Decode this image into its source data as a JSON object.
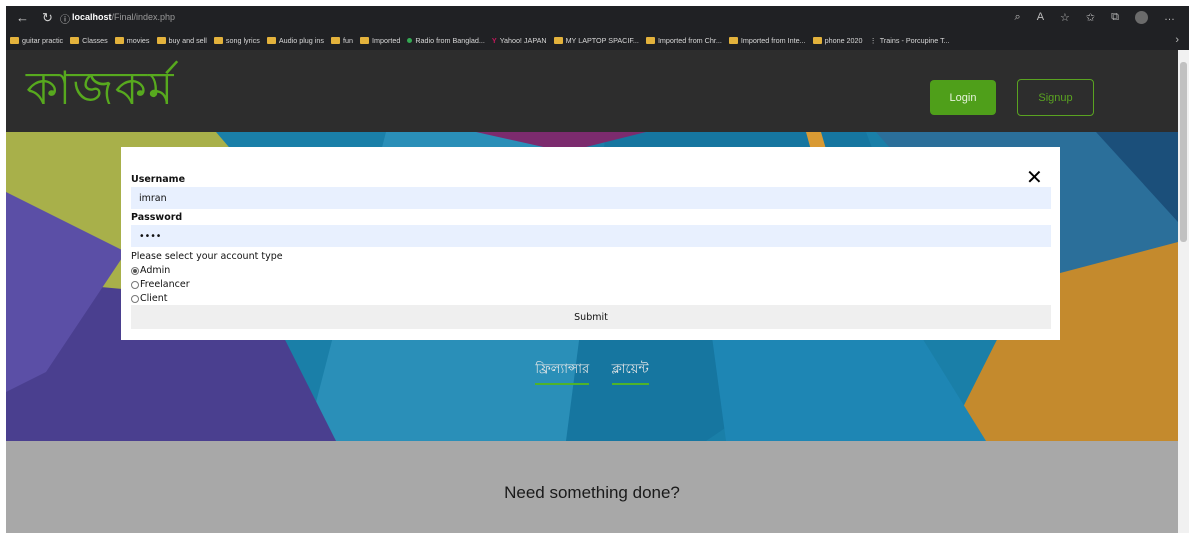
{
  "browser": {
    "url_host": "localhost",
    "url_path": "/Final/index.php",
    "bookmarks": [
      {
        "label": "guitar practic",
        "icon": "folder-icon"
      },
      {
        "label": "Classes",
        "icon": "folder-icon"
      },
      {
        "label": "movies",
        "icon": "folder-icon"
      },
      {
        "label": "buy and sell",
        "icon": "folder-icon"
      },
      {
        "label": "song lyrics",
        "icon": "folder-icon"
      },
      {
        "label": "Audio plug ins",
        "icon": "folder-icon"
      },
      {
        "label": "fun",
        "icon": "folder-icon"
      },
      {
        "label": "Imported",
        "icon": "folder-icon"
      },
      {
        "label": "Radio from Banglad...",
        "icon": "radio-icon"
      },
      {
        "label": "Yahoo! JAPAN",
        "icon": "yahoo-icon"
      },
      {
        "label": "MY LAPTOP SPACIF...",
        "icon": "folder-icon"
      },
      {
        "label": "Imported from Chr...",
        "icon": "folder-icon"
      },
      {
        "label": "Imported from Inte...",
        "icon": "folder-icon"
      },
      {
        "label": "phone 2020",
        "icon": "folder-icon"
      },
      {
        "label": "Trains - Porcupine T...",
        "icon": "train-icon"
      }
    ]
  },
  "header": {
    "logo": "কাজকর্ম",
    "login_label": "Login",
    "signup_label": "Signup"
  },
  "modal": {
    "username_label": "Username",
    "username_value": "imran",
    "password_label": "Password",
    "password_value": "••••",
    "account_prompt": "Please select your account type",
    "options": [
      {
        "label": "Admin",
        "checked": true
      },
      {
        "label": "Freelancer",
        "checked": false
      },
      {
        "label": "Client",
        "checked": false
      }
    ],
    "submit_label": "Submit",
    "close_glyph": "✕"
  },
  "hero": {
    "links": [
      "ফ্রিল্যান্সার",
      "ক্লায়েন্ট"
    ]
  },
  "section": {
    "title": "Need something done?"
  },
  "colors": {
    "brand_green": "#57a91e",
    "header_bg": "#2d2d2d",
    "field_bg": "#e8f0fe"
  }
}
